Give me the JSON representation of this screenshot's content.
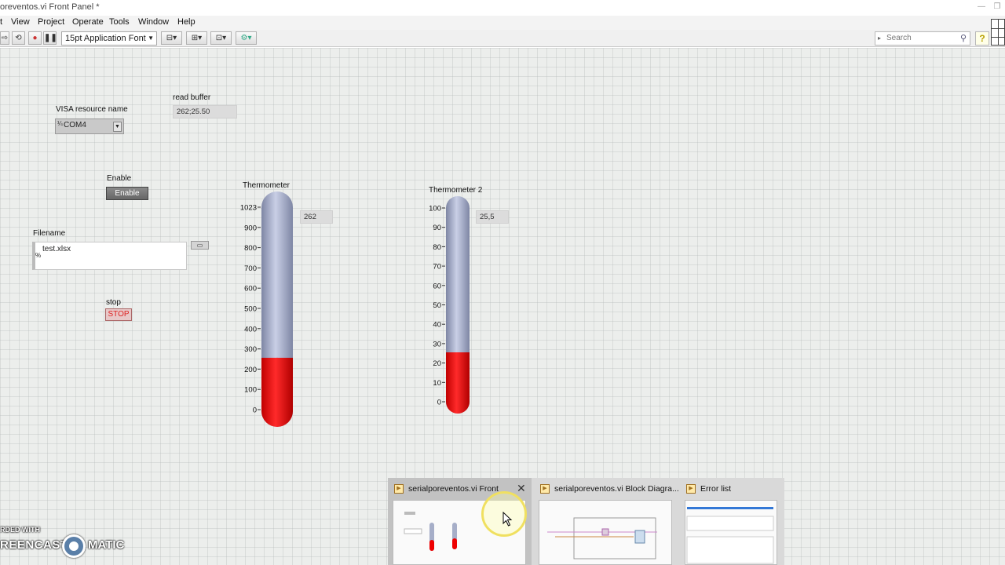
{
  "window": {
    "title": "oreventos.vi Front Panel *"
  },
  "menu": [
    "View",
    "Project",
    "Operate",
    "Tools",
    "Window",
    "Help"
  ],
  "toolbar": {
    "font": "15pt Application Font",
    "search_placeholder": "Search"
  },
  "controls": {
    "visa": {
      "label": "VISA resource name",
      "value": "COM4"
    },
    "read_buffer": {
      "label": "read buffer",
      "value": "262;25.50"
    },
    "enable": {
      "label": "Enable",
      "button": "Enable"
    },
    "filename": {
      "label": "Filename",
      "value": "test.xlsx"
    },
    "stop": {
      "label": "stop",
      "button": "STOP"
    }
  },
  "thermometers": [
    {
      "label": "Thermometer",
      "value_text": "262",
      "value": 262,
      "max": 1023,
      "ticks": [
        "1023",
        "900",
        "800",
        "700",
        "600",
        "500",
        "400",
        "300",
        "200",
        "100",
        "0"
      ]
    },
    {
      "label": "Thermometer 2",
      "value_text": "25,5",
      "value": 25.5,
      "max": 100,
      "ticks": [
        "100",
        "90",
        "80",
        "70",
        "60",
        "50",
        "40",
        "30",
        "20",
        "10",
        "0"
      ]
    }
  ],
  "taskbar": [
    {
      "title": "serialporeventos.vi Front"
    },
    {
      "title": "serialporeventos.vi Block Diagra..."
    },
    {
      "title": "Error list"
    }
  ],
  "watermark": {
    "line1": "RDED WITH",
    "line2": "REENCAST",
    "line3": "MATIC"
  },
  "colors": {
    "mercury": "#ff0000",
    "tube": "#a6aec8"
  }
}
